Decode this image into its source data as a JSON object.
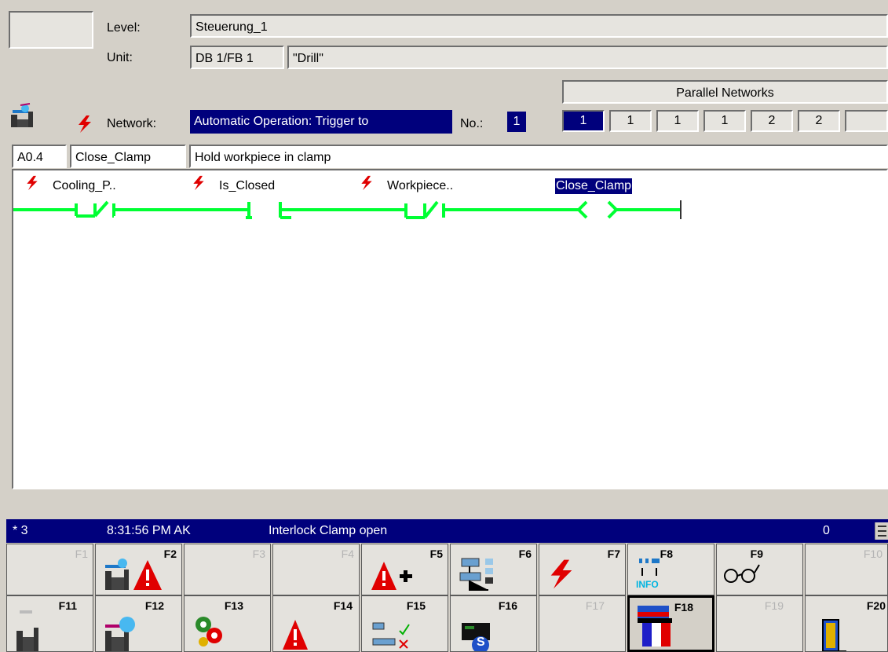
{
  "header": {
    "level_label": "Level:",
    "level_value": "Steuerung_1",
    "unit_label": "Unit:",
    "unit_value": "DB 1/FB 1",
    "unit_name": "\"Drill\""
  },
  "parallel_networks": {
    "title": "Parallel Networks",
    "values": [
      "1",
      "1",
      "1",
      "1",
      "2",
      "2",
      ""
    ]
  },
  "network": {
    "label": "Network:",
    "value": "Automatic Operation: Trigger to",
    "no_label": "No.:",
    "no_value": "1"
  },
  "operand": {
    "address": "A0.4",
    "symbol": "Close_Clamp",
    "comment": "Hold workpiece in clamp"
  },
  "ladder": {
    "contacts": [
      {
        "label": "Cooling_P..",
        "type": "NC"
      },
      {
        "label": "Is_Closed",
        "type": "NO"
      },
      {
        "label": "Workpiece..",
        "type": "NC"
      }
    ],
    "coil": "Close_Clamp"
  },
  "status": {
    "marker": "* 3",
    "time": "8:31:56 PM AK",
    "message": "Interlock Clamp open",
    "count": "0"
  },
  "fkeys": {
    "row1": [
      {
        "label": "F1",
        "icon": "empty",
        "enabled": false
      },
      {
        "label": "F2",
        "icon": "operator-alarm-icon",
        "enabled": true
      },
      {
        "label": "F3",
        "icon": "empty",
        "enabled": false
      },
      {
        "label": "F4",
        "icon": "empty",
        "enabled": false
      },
      {
        "label": "F5",
        "icon": "alarm-plus-icon",
        "enabled": true
      },
      {
        "label": "F6",
        "icon": "network-overview-icon",
        "enabled": true
      },
      {
        "label": "F7",
        "icon": "lightning-icon",
        "enabled": true
      },
      {
        "label": "F8",
        "icon": "info-icon",
        "enabled": true,
        "icon_text": "INFO"
      },
      {
        "label": "F9",
        "icon": "glasses-icon",
        "enabled": true
      },
      {
        "label": "F10",
        "icon": "empty",
        "enabled": false
      }
    ],
    "row2": [
      {
        "label": "F11",
        "icon": "station-icon",
        "enabled": true
      },
      {
        "label": "F12",
        "icon": "operator-icon",
        "enabled": true
      },
      {
        "label": "F13",
        "icon": "cogs-icon",
        "enabled": true
      },
      {
        "label": "F14",
        "icon": "alarm-icon",
        "enabled": true
      },
      {
        "label": "F15",
        "icon": "network-check-icon",
        "enabled": true
      },
      {
        "label": "F16",
        "icon": "step-icon",
        "enabled": true,
        "icon_text": "S"
      },
      {
        "label": "F17",
        "icon": "empty",
        "enabled": false
      },
      {
        "label": "F18",
        "icon": "language-flag-icon",
        "enabled": true
      },
      {
        "label": "F19",
        "icon": "empty",
        "enabled": false
      },
      {
        "label": "F20",
        "icon": "exit-door-icon",
        "enabled": true
      }
    ]
  },
  "colors": {
    "background": "#d4d0c8",
    "selection": "#00007c",
    "ladder_line": "#00ff33",
    "alarm_red": "#e00000"
  }
}
